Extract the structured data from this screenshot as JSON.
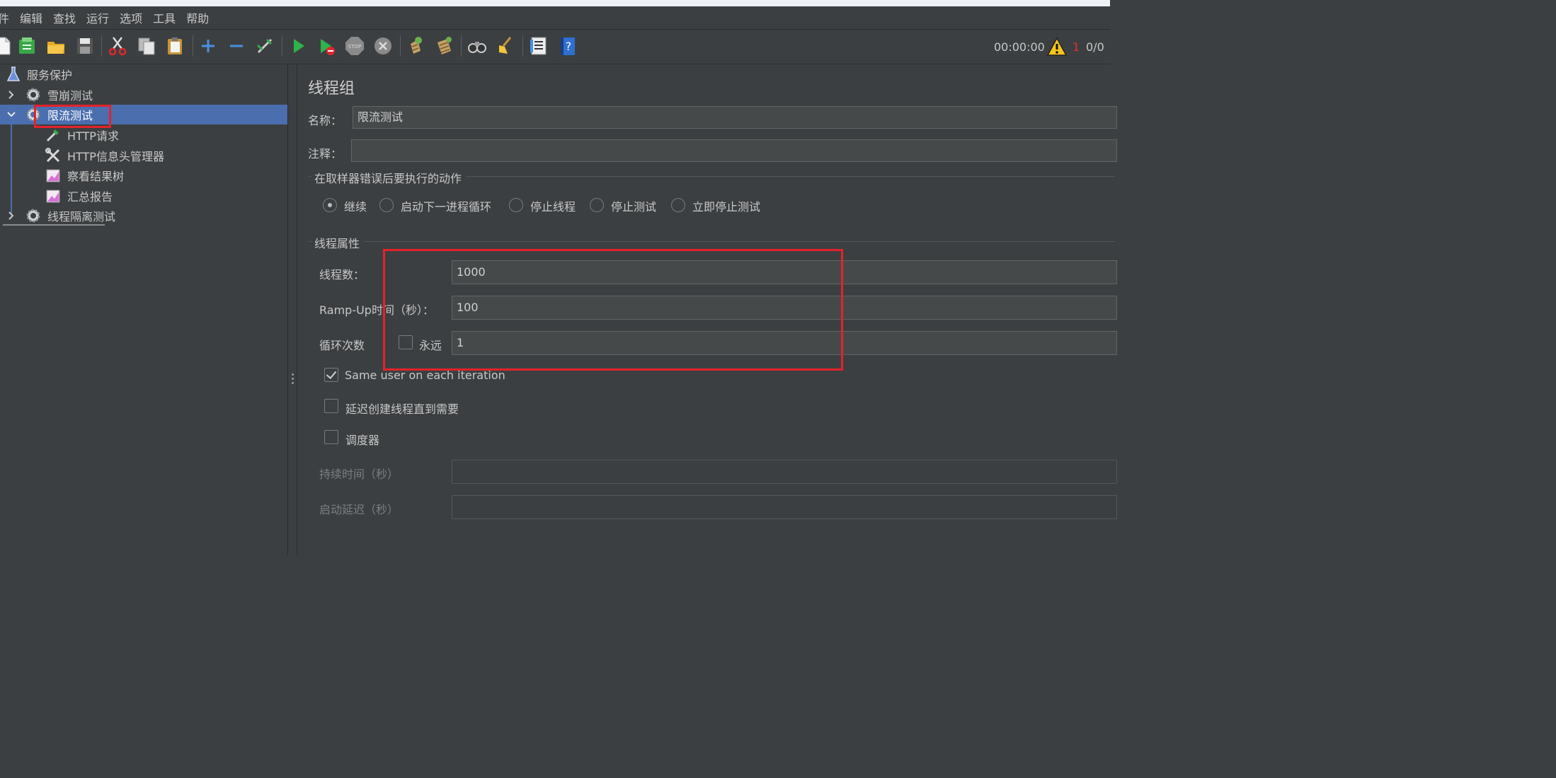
{
  "menu": [
    "件",
    "编辑",
    "查找",
    "运行",
    "选项",
    "工具",
    "帮助"
  ],
  "toolbar": {
    "icons": [
      "new-icon",
      "templates-icon",
      "open-icon",
      "save-icon",
      "cut-icon",
      "copy-icon",
      "paste-icon",
      "expand-icon",
      "collapse-icon",
      "toggle-icon",
      "start-icon",
      "start-no-pause-icon",
      "stop-icon",
      "shutdown-icon",
      "clear-icon",
      "clear-all-icon",
      "search-icon",
      "reset-search-icon",
      "function-helper-icon",
      "help-icon"
    ],
    "timer": "00:00:00",
    "warning_count": "1",
    "threads": "0/0"
  },
  "tree": {
    "items": [
      {
        "label": "服务保护",
        "icon": "test-plan-icon"
      },
      {
        "label": "雪崩测试",
        "icon": "thread-group-gear-icon"
      },
      {
        "label": "限流测试",
        "icon": "thread-group-gear-icon"
      },
      {
        "label": "HTTP请求",
        "icon": "sampler-pipette-icon"
      },
      {
        "label": "HTTP信息头管理器",
        "icon": "config-tools-icon"
      },
      {
        "label": "察看结果树",
        "icon": "listener-graph-icon"
      },
      {
        "label": "汇总报告",
        "icon": "listener-graph-icon"
      },
      {
        "label": "线程隔离测试",
        "icon": "thread-group-gear-icon"
      }
    ]
  },
  "panel": {
    "title": "线程组",
    "name_label": "名称：",
    "name_value": "限流测试",
    "comment_label": "注释：",
    "comment_value": "",
    "error_section": "在取样器错误后要执行的动作",
    "error_actions": [
      "继续",
      "启动下一进程循环",
      "停止线程",
      "停止测试",
      "立即停止测试"
    ],
    "thread_section": "线程属性",
    "threads_label": "线程数：",
    "threads_value": "1000",
    "rampup_label": "Ramp-Up时间（秒）：",
    "rampup_value": "100",
    "loop_label": "循环次数",
    "forever_label": "永远",
    "loop_value": "1",
    "same_user_label": "Same user on each iteration",
    "delay_label": "延迟创建线程直到需要",
    "scheduler_label": "调度器",
    "duration_label": "持续时间（秒）",
    "startup_delay_label": "启动延迟（秒）",
    "selected_action": "继续",
    "same_user_checked": true,
    "delay_checked": false,
    "scheduler_checked": false,
    "forever_checked": false
  }
}
